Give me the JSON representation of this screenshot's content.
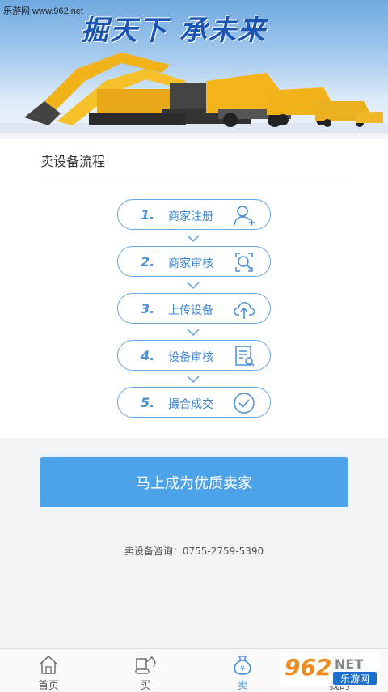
{
  "banner": {
    "watermark": "乐游网 www.962.net",
    "slogan": "掘天下 承未来"
  },
  "process": {
    "title": "卖设备流程",
    "steps": [
      {
        "num": "1.",
        "label": "商家注册",
        "icon": "add-user-icon"
      },
      {
        "num": "2.",
        "label": "商家审核",
        "icon": "search-review-icon"
      },
      {
        "num": "3.",
        "label": "上传设备",
        "icon": "cloud-upload-icon"
      },
      {
        "num": "4.",
        "label": "设备审核",
        "icon": "document-review-icon"
      },
      {
        "num": "5.",
        "label": "撮合成交",
        "icon": "check-circle-icon"
      }
    ]
  },
  "cta": {
    "label": "马上成为优质卖家"
  },
  "consult": {
    "text": "卖设备咨询：0755-2759-5390"
  },
  "tabbar": {
    "tabs": [
      {
        "label": "首页",
        "icon": "home-icon"
      },
      {
        "label": "买",
        "icon": "excavator-icon"
      },
      {
        "label": "卖",
        "icon": "money-bag-icon"
      },
      {
        "label": "我的",
        "icon": "person-icon"
      }
    ],
    "active": "卖"
  },
  "overlay_logo": {
    "text": "962",
    "suffix": "NET",
    "caption": "乐游网"
  },
  "colors": {
    "accent": "#4da3ea",
    "step_border": "#6aa8e0",
    "banner_sky": "#6fa9e0"
  }
}
